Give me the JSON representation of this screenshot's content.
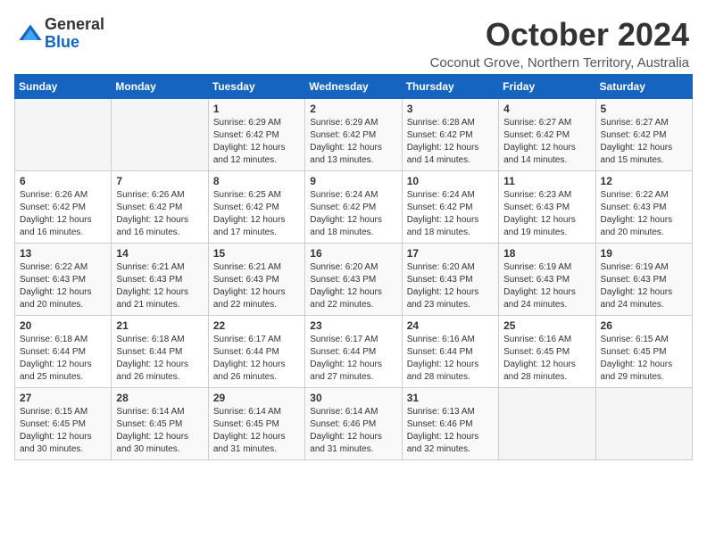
{
  "logo": {
    "general": "General",
    "blue": "Blue"
  },
  "title": "October 2024",
  "subtitle": "Coconut Grove, Northern Territory, Australia",
  "days_of_week": [
    "Sunday",
    "Monday",
    "Tuesday",
    "Wednesday",
    "Thursday",
    "Friday",
    "Saturday"
  ],
  "weeks": [
    [
      {
        "day": "",
        "info": ""
      },
      {
        "day": "",
        "info": ""
      },
      {
        "day": "1",
        "info": "Sunrise: 6:29 AM\nSunset: 6:42 PM\nDaylight: 12 hours\nand 12 minutes."
      },
      {
        "day": "2",
        "info": "Sunrise: 6:29 AM\nSunset: 6:42 PM\nDaylight: 12 hours\nand 13 minutes."
      },
      {
        "day": "3",
        "info": "Sunrise: 6:28 AM\nSunset: 6:42 PM\nDaylight: 12 hours\nand 14 minutes."
      },
      {
        "day": "4",
        "info": "Sunrise: 6:27 AM\nSunset: 6:42 PM\nDaylight: 12 hours\nand 14 minutes."
      },
      {
        "day": "5",
        "info": "Sunrise: 6:27 AM\nSunset: 6:42 PM\nDaylight: 12 hours\nand 15 minutes."
      }
    ],
    [
      {
        "day": "6",
        "info": "Sunrise: 6:26 AM\nSunset: 6:42 PM\nDaylight: 12 hours\nand 16 minutes."
      },
      {
        "day": "7",
        "info": "Sunrise: 6:26 AM\nSunset: 6:42 PM\nDaylight: 12 hours\nand 16 minutes."
      },
      {
        "day": "8",
        "info": "Sunrise: 6:25 AM\nSunset: 6:42 PM\nDaylight: 12 hours\nand 17 minutes."
      },
      {
        "day": "9",
        "info": "Sunrise: 6:24 AM\nSunset: 6:42 PM\nDaylight: 12 hours\nand 18 minutes."
      },
      {
        "day": "10",
        "info": "Sunrise: 6:24 AM\nSunset: 6:42 PM\nDaylight: 12 hours\nand 18 minutes."
      },
      {
        "day": "11",
        "info": "Sunrise: 6:23 AM\nSunset: 6:43 PM\nDaylight: 12 hours\nand 19 minutes."
      },
      {
        "day": "12",
        "info": "Sunrise: 6:22 AM\nSunset: 6:43 PM\nDaylight: 12 hours\nand 20 minutes."
      }
    ],
    [
      {
        "day": "13",
        "info": "Sunrise: 6:22 AM\nSunset: 6:43 PM\nDaylight: 12 hours\nand 20 minutes."
      },
      {
        "day": "14",
        "info": "Sunrise: 6:21 AM\nSunset: 6:43 PM\nDaylight: 12 hours\nand 21 minutes."
      },
      {
        "day": "15",
        "info": "Sunrise: 6:21 AM\nSunset: 6:43 PM\nDaylight: 12 hours\nand 22 minutes."
      },
      {
        "day": "16",
        "info": "Sunrise: 6:20 AM\nSunset: 6:43 PM\nDaylight: 12 hours\nand 22 minutes."
      },
      {
        "day": "17",
        "info": "Sunrise: 6:20 AM\nSunset: 6:43 PM\nDaylight: 12 hours\nand 23 minutes."
      },
      {
        "day": "18",
        "info": "Sunrise: 6:19 AM\nSunset: 6:43 PM\nDaylight: 12 hours\nand 24 minutes."
      },
      {
        "day": "19",
        "info": "Sunrise: 6:19 AM\nSunset: 6:43 PM\nDaylight: 12 hours\nand 24 minutes."
      }
    ],
    [
      {
        "day": "20",
        "info": "Sunrise: 6:18 AM\nSunset: 6:44 PM\nDaylight: 12 hours\nand 25 minutes."
      },
      {
        "day": "21",
        "info": "Sunrise: 6:18 AM\nSunset: 6:44 PM\nDaylight: 12 hours\nand 26 minutes."
      },
      {
        "day": "22",
        "info": "Sunrise: 6:17 AM\nSunset: 6:44 PM\nDaylight: 12 hours\nand 26 minutes."
      },
      {
        "day": "23",
        "info": "Sunrise: 6:17 AM\nSunset: 6:44 PM\nDaylight: 12 hours\nand 27 minutes."
      },
      {
        "day": "24",
        "info": "Sunrise: 6:16 AM\nSunset: 6:44 PM\nDaylight: 12 hours\nand 28 minutes."
      },
      {
        "day": "25",
        "info": "Sunrise: 6:16 AM\nSunset: 6:45 PM\nDaylight: 12 hours\nand 28 minutes."
      },
      {
        "day": "26",
        "info": "Sunrise: 6:15 AM\nSunset: 6:45 PM\nDaylight: 12 hours\nand 29 minutes."
      }
    ],
    [
      {
        "day": "27",
        "info": "Sunrise: 6:15 AM\nSunset: 6:45 PM\nDaylight: 12 hours\nand 30 minutes."
      },
      {
        "day": "28",
        "info": "Sunrise: 6:14 AM\nSunset: 6:45 PM\nDaylight: 12 hours\nand 30 minutes."
      },
      {
        "day": "29",
        "info": "Sunrise: 6:14 AM\nSunset: 6:45 PM\nDaylight: 12 hours\nand 31 minutes."
      },
      {
        "day": "30",
        "info": "Sunrise: 6:14 AM\nSunset: 6:46 PM\nDaylight: 12 hours\nand 31 minutes."
      },
      {
        "day": "31",
        "info": "Sunrise: 6:13 AM\nSunset: 6:46 PM\nDaylight: 12 hours\nand 32 minutes."
      },
      {
        "day": "",
        "info": ""
      },
      {
        "day": "",
        "info": ""
      }
    ]
  ]
}
